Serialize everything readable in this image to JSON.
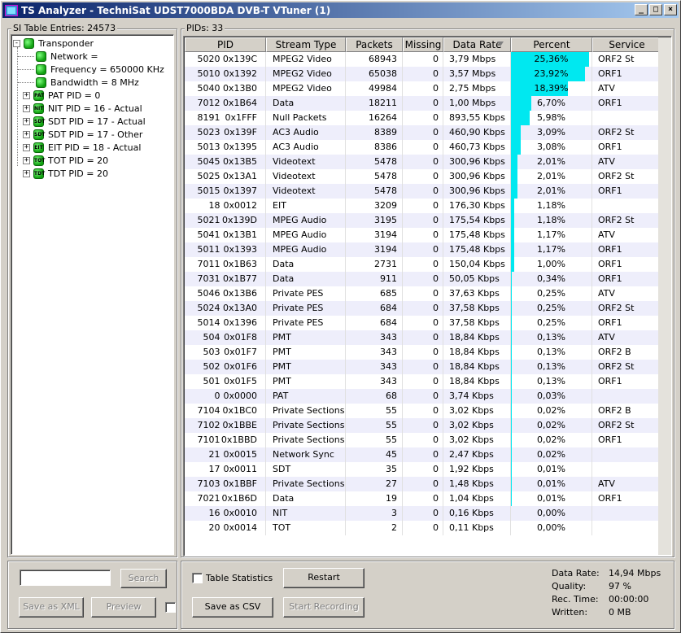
{
  "window": {
    "title": "TS Analyzer - TechniSat UDST7000BDA DVB-T VTuner (1)",
    "minimize": "_",
    "maximize": "□",
    "close": "×"
  },
  "si": {
    "label": "SI Table Entries: 24573",
    "tree": {
      "root": "Transponder",
      "children": [
        "Network =",
        "Frequency = 650000 KHz",
        "Bandwidth = 8 MHz"
      ],
      "tables": [
        {
          "label": "PAT PID = 0",
          "tag": "PAT"
        },
        {
          "label": "NIT PID = 16 - Actual",
          "tag": "NIT"
        },
        {
          "label": "SDT PID = 17 - Actual",
          "tag": "SDT"
        },
        {
          "label": "SDT PID = 17 - Other",
          "tag": "SDT"
        },
        {
          "label": "EIT PID = 18 - Actual",
          "tag": "EIT"
        },
        {
          "label": "TOT PID = 20",
          "tag": "TOT"
        },
        {
          "label": "TDT PID = 20",
          "tag": "TDT"
        }
      ]
    },
    "search_value": "",
    "search_button": "Search",
    "save_xml_button": "Save as XML",
    "preview_button": "Preview"
  },
  "pids": {
    "label": "PIDs: 33",
    "columns": [
      "PID",
      "Stream Type",
      "Packets",
      "Missing",
      "Data Rate",
      "Percent",
      "Service"
    ],
    "rows": [
      {
        "dec": "5020",
        "hex": "0x139C",
        "type": "MPEG2 Video",
        "packets": "68943",
        "missing": "0",
        "rate": "3,79 Mbps",
        "percent": "25,36%",
        "pct": 25.36,
        "service": "ORF2 St"
      },
      {
        "dec": "5010",
        "hex": "0x1392",
        "type": "MPEG2 Video",
        "packets": "65038",
        "missing": "0",
        "rate": "3,57 Mbps",
        "percent": "23,92%",
        "pct": 23.92,
        "service": "ORF1"
      },
      {
        "dec": "5040",
        "hex": "0x13B0",
        "type": "MPEG2 Video",
        "packets": "49984",
        "missing": "0",
        "rate": "2,75 Mbps",
        "percent": "18,39%",
        "pct": 18.39,
        "service": "ATV"
      },
      {
        "dec": "7012",
        "hex": "0x1B64",
        "type": "Data",
        "packets": "18211",
        "missing": "0",
        "rate": "1,00 Mbps",
        "percent": "6,70%",
        "pct": 6.7,
        "service": "ORF1"
      },
      {
        "dec": "8191",
        "hex": "0x1FFF",
        "type": "Null Packets",
        "packets": "16264",
        "missing": "0",
        "rate": "893,55 Kbps",
        "percent": "5,98%",
        "pct": 5.98,
        "service": ""
      },
      {
        "dec": "5023",
        "hex": "0x139F",
        "type": "AC3 Audio",
        "packets": "8389",
        "missing": "0",
        "rate": "460,90 Kbps",
        "percent": "3,09%",
        "pct": 3.09,
        "service": "ORF2 St"
      },
      {
        "dec": "5013",
        "hex": "0x1395",
        "type": "AC3 Audio",
        "packets": "8386",
        "missing": "0",
        "rate": "460,73 Kbps",
        "percent": "3,08%",
        "pct": 3.08,
        "service": "ORF1"
      },
      {
        "dec": "5045",
        "hex": "0x13B5",
        "type": "Videotext",
        "packets": "5478",
        "missing": "0",
        "rate": "300,96 Kbps",
        "percent": "2,01%",
        "pct": 2.01,
        "service": "ATV"
      },
      {
        "dec": "5025",
        "hex": "0x13A1",
        "type": "Videotext",
        "packets": "5478",
        "missing": "0",
        "rate": "300,96 Kbps",
        "percent": "2,01%",
        "pct": 2.01,
        "service": "ORF2 St"
      },
      {
        "dec": "5015",
        "hex": "0x1397",
        "type": "Videotext",
        "packets": "5478",
        "missing": "0",
        "rate": "300,96 Kbps",
        "percent": "2,01%",
        "pct": 2.01,
        "service": "ORF1"
      },
      {
        "dec": "18",
        "hex": "0x0012",
        "type": "EIT",
        "packets": "3209",
        "missing": "0",
        "rate": "176,30 Kbps",
        "percent": "1,18%",
        "pct": 1.18,
        "service": ""
      },
      {
        "dec": "5021",
        "hex": "0x139D",
        "type": "MPEG Audio",
        "packets": "3195",
        "missing": "0",
        "rate": "175,54 Kbps",
        "percent": "1,18%",
        "pct": 1.18,
        "service": "ORF2 St"
      },
      {
        "dec": "5041",
        "hex": "0x13B1",
        "type": "MPEG Audio",
        "packets": "3194",
        "missing": "0",
        "rate": "175,48 Kbps",
        "percent": "1,17%",
        "pct": 1.17,
        "service": "ATV"
      },
      {
        "dec": "5011",
        "hex": "0x1393",
        "type": "MPEG Audio",
        "packets": "3194",
        "missing": "0",
        "rate": "175,48 Kbps",
        "percent": "1,17%",
        "pct": 1.17,
        "service": "ORF1"
      },
      {
        "dec": "7011",
        "hex": "0x1B63",
        "type": "Data",
        "packets": "2731",
        "missing": "0",
        "rate": "150,04 Kbps",
        "percent": "1,00%",
        "pct": 1.0,
        "service": "ORF1"
      },
      {
        "dec": "7031",
        "hex": "0x1B77",
        "type": "Data",
        "packets": "911",
        "missing": "0",
        "rate": "50,05 Kbps",
        "percent": "0,34%",
        "pct": 0.34,
        "service": "ORF1"
      },
      {
        "dec": "5046",
        "hex": "0x13B6",
        "type": "Private PES",
        "packets": "685",
        "missing": "0",
        "rate": "37,63 Kbps",
        "percent": "0,25%",
        "pct": 0.25,
        "service": "ATV"
      },
      {
        "dec": "5024",
        "hex": "0x13A0",
        "type": "Private PES",
        "packets": "684",
        "missing": "0",
        "rate": "37,58 Kbps",
        "percent": "0,25%",
        "pct": 0.25,
        "service": "ORF2 St"
      },
      {
        "dec": "5014",
        "hex": "0x1396",
        "type": "Private PES",
        "packets": "684",
        "missing": "0",
        "rate": "37,58 Kbps",
        "percent": "0,25%",
        "pct": 0.25,
        "service": "ORF1"
      },
      {
        "dec": "504",
        "hex": "0x01F8",
        "type": "PMT",
        "packets": "343",
        "missing": "0",
        "rate": "18,84 Kbps",
        "percent": "0,13%",
        "pct": 0.13,
        "service": "ATV"
      },
      {
        "dec": "503",
        "hex": "0x01F7",
        "type": "PMT",
        "packets": "343",
        "missing": "0",
        "rate": "18,84 Kbps",
        "percent": "0,13%",
        "pct": 0.13,
        "service": "ORF2 B"
      },
      {
        "dec": "502",
        "hex": "0x01F6",
        "type": "PMT",
        "packets": "343",
        "missing": "0",
        "rate": "18,84 Kbps",
        "percent": "0,13%",
        "pct": 0.13,
        "service": "ORF2 St"
      },
      {
        "dec": "501",
        "hex": "0x01F5",
        "type": "PMT",
        "packets": "343",
        "missing": "0",
        "rate": "18,84 Kbps",
        "percent": "0,13%",
        "pct": 0.13,
        "service": "ORF1"
      },
      {
        "dec": "0",
        "hex": "0x0000",
        "type": "PAT",
        "packets": "68",
        "missing": "0",
        "rate": "3,74 Kbps",
        "percent": "0,03%",
        "pct": 0.03,
        "service": ""
      },
      {
        "dec": "7104",
        "hex": "0x1BC0",
        "type": "Private Sections",
        "packets": "55",
        "missing": "0",
        "rate": "3,02 Kbps",
        "percent": "0,02%",
        "pct": 0.02,
        "service": "ORF2 B"
      },
      {
        "dec": "7102",
        "hex": "0x1BBE",
        "type": "Private Sections",
        "packets": "55",
        "missing": "0",
        "rate": "3,02 Kbps",
        "percent": "0,02%",
        "pct": 0.02,
        "service": "ORF2 St"
      },
      {
        "dec": "7101",
        "hex": "0x1BBD",
        "type": "Private Sections",
        "packets": "55",
        "missing": "0",
        "rate": "3,02 Kbps",
        "percent": "0,02%",
        "pct": 0.02,
        "service": "ORF1"
      },
      {
        "dec": "21",
        "hex": "0x0015",
        "type": "Network Sync",
        "packets": "45",
        "missing": "0",
        "rate": "2,47 Kbps",
        "percent": "0,02%",
        "pct": 0.02,
        "service": ""
      },
      {
        "dec": "17",
        "hex": "0x0011",
        "type": "SDT",
        "packets": "35",
        "missing": "0",
        "rate": "1,92 Kbps",
        "percent": "0,01%",
        "pct": 0.01,
        "service": ""
      },
      {
        "dec": "7103",
        "hex": "0x1BBF",
        "type": "Private Sections",
        "packets": "27",
        "missing": "0",
        "rate": "1,48 Kbps",
        "percent": "0,01%",
        "pct": 0.01,
        "service": "ATV"
      },
      {
        "dec": "7021",
        "hex": "0x1B6D",
        "type": "Data",
        "packets": "19",
        "missing": "0",
        "rate": "1,04 Kbps",
        "percent": "0,01%",
        "pct": 0.01,
        "service": "ORF1"
      },
      {
        "dec": "16",
        "hex": "0x0010",
        "type": "NIT",
        "packets": "3",
        "missing": "0",
        "rate": "0,16 Kbps",
        "percent": "0,00%",
        "pct": 0.0,
        "service": ""
      },
      {
        "dec": "20",
        "hex": "0x0014",
        "type": "TOT",
        "packets": "2",
        "missing": "0",
        "rate": "0,11 Kbps",
        "percent": "0,00%",
        "pct": 0.0,
        "service": ""
      }
    ]
  },
  "bottom": {
    "table_statistics": "Table Statistics",
    "restart_button": "Restart",
    "save_csv_button": "Save as CSV",
    "start_recording_button": "Start Recording",
    "status": [
      {
        "label": "Data Rate:",
        "value": "14,94 Mbps"
      },
      {
        "label": "Quality:",
        "value": "97 %"
      },
      {
        "label": "Rec. Time:",
        "value": "00:00:00"
      },
      {
        "label": "Written:",
        "value": "0 MB"
      }
    ]
  },
  "colors": {
    "bar": "#00e8f0",
    "title_start": "#0a246a",
    "title_end": "#a6caf0"
  }
}
